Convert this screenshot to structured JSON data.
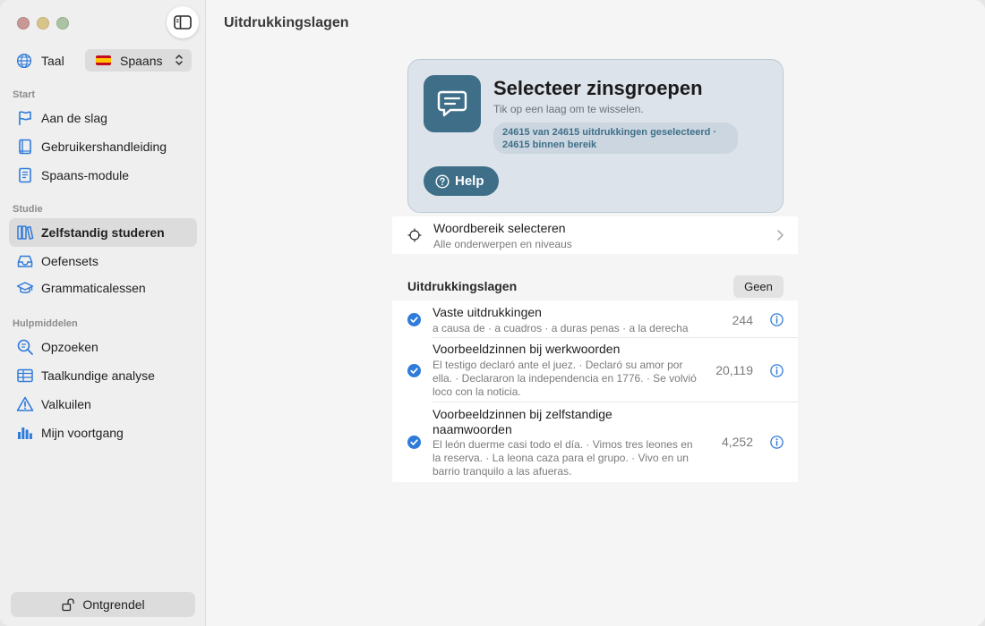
{
  "main": {
    "title": "Uitdrukkingslagen"
  },
  "sidebar": {
    "language": {
      "label": "Taal",
      "selected": "Spaans"
    },
    "sections": [
      {
        "title": "Start",
        "items": [
          {
            "label": "Aan de slag",
            "icon": "flag-icon"
          },
          {
            "label": "Gebruikershandleiding",
            "icon": "book-icon"
          },
          {
            "label": "Spaans-module",
            "icon": "module-book-icon"
          }
        ]
      },
      {
        "title": "Studie",
        "items": [
          {
            "label": "Zelfstandig studeren",
            "icon": "books-icon",
            "active": true
          },
          {
            "label": "Oefensets",
            "icon": "tray-icon"
          },
          {
            "label": "Grammaticalessen",
            "icon": "graduation-cap-icon"
          }
        ]
      },
      {
        "title": "Hulpmiddelen",
        "items": [
          {
            "label": "Opzoeken",
            "icon": "search-text-icon"
          },
          {
            "label": "Taalkundige analyse",
            "icon": "table-icon"
          },
          {
            "label": "Valkuilen",
            "icon": "warning-icon"
          },
          {
            "label": "Mijn voortgang",
            "icon": "bar-chart-icon"
          }
        ]
      }
    ],
    "unlock_label": "Ontgrendel"
  },
  "hero": {
    "title": "Selecteer zinsgroepen",
    "subtitle": "Tik op een laag om te wisselen.",
    "pill": "24615 van 24615 uitdrukkingen geselecteerd · 24615 binnen bereik",
    "help_label": "Help"
  },
  "range": {
    "title": "Woordbereik selecteren",
    "subtitle": "Alle onderwerpen en niveaus"
  },
  "layers": {
    "header": "Uitdrukkingslagen",
    "none_label": "Geen",
    "items": [
      {
        "title": "Vaste uitdrukkingen",
        "examples": "a causa de · a cuadros · a duras penas · a la derecha",
        "count": "244",
        "checked": true
      },
      {
        "title": "Voorbeeldzinnen bij werkwoorden",
        "examples": "El testigo declaró ante el juez. · Declaró su amor por ella. · Declararon la independencia en 1776. · Se volvió loco con la noticia.",
        "count": "20,119",
        "checked": true
      },
      {
        "title": "Voorbeeldzinnen bij zelfstandige naamwoorden",
        "examples": "El león duerme casi todo el día. · Vimos tres leones en la reserva. · La leona caza para el grupo. · Vivo en un barrio tranquilo a las afueras.",
        "count": "4,252",
        "checked": true
      }
    ]
  },
  "colors": {
    "accent": "#3f6f88",
    "link_blue": "#2f7bd9",
    "sidebar_bg": "#efefef"
  }
}
